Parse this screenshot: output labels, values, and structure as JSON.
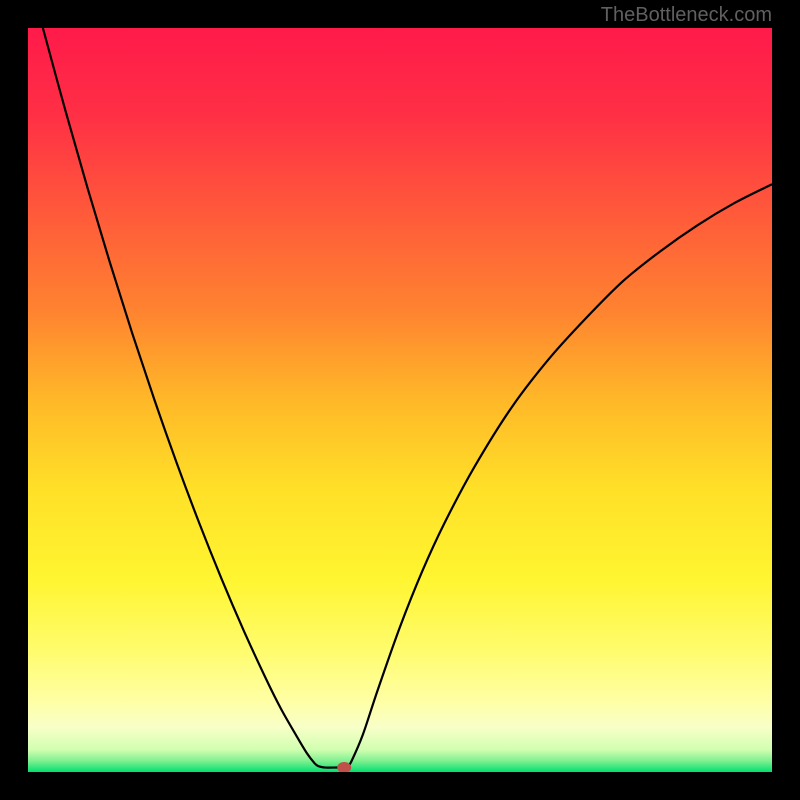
{
  "watermark": "TheBottleneck.com",
  "chart_data": {
    "type": "line",
    "title": "",
    "xlabel": "",
    "ylabel": "",
    "xlim": [
      0,
      100
    ],
    "ylim": [
      0,
      100
    ],
    "background_gradient": {
      "stops": [
        {
          "offset": 0.0,
          "color": "#ff1a4a"
        },
        {
          "offset": 0.12,
          "color": "#ff3045"
        },
        {
          "offset": 0.25,
          "color": "#ff5a3a"
        },
        {
          "offset": 0.38,
          "color": "#ff8330"
        },
        {
          "offset": 0.5,
          "color": "#ffb828"
        },
        {
          "offset": 0.62,
          "color": "#ffe028"
        },
        {
          "offset": 0.74,
          "color": "#fff530"
        },
        {
          "offset": 0.84,
          "color": "#fffc70"
        },
        {
          "offset": 0.9,
          "color": "#ffffa0"
        },
        {
          "offset": 0.94,
          "color": "#f8ffc8"
        },
        {
          "offset": 0.97,
          "color": "#d0ffb0"
        },
        {
          "offset": 0.985,
          "color": "#80f090"
        },
        {
          "offset": 1.0,
          "color": "#00e070"
        }
      ]
    },
    "series": [
      {
        "name": "bottleneck-curve",
        "type": "path",
        "stroke": "#000000",
        "points": [
          {
            "x": 2.0,
            "y": 100.0
          },
          {
            "x": 5.0,
            "y": 89.0
          },
          {
            "x": 8.0,
            "y": 78.5
          },
          {
            "x": 11.0,
            "y": 68.5
          },
          {
            "x": 14.0,
            "y": 59.0
          },
          {
            "x": 17.0,
            "y": 50.0
          },
          {
            "x": 20.0,
            "y": 41.5
          },
          {
            "x": 23.0,
            "y": 33.5
          },
          {
            "x": 26.0,
            "y": 26.0
          },
          {
            "x": 29.0,
            "y": 19.0
          },
          {
            "x": 32.0,
            "y": 12.5
          },
          {
            "x": 34.0,
            "y": 8.5
          },
          {
            "x": 36.0,
            "y": 5.0
          },
          {
            "x": 37.5,
            "y": 2.5
          },
          {
            "x": 38.5,
            "y": 1.2
          },
          {
            "x": 39.0,
            "y": 0.8
          },
          {
            "x": 40.0,
            "y": 0.6
          },
          {
            "x": 41.5,
            "y": 0.6
          },
          {
            "x": 42.5,
            "y": 0.6
          },
          {
            "x": 43.0,
            "y": 0.8
          },
          {
            "x": 43.5,
            "y": 1.5
          },
          {
            "x": 45.0,
            "y": 5.0
          },
          {
            "x": 47.0,
            "y": 11.0
          },
          {
            "x": 50.0,
            "y": 19.5
          },
          {
            "x": 53.0,
            "y": 27.0
          },
          {
            "x": 56.0,
            "y": 33.5
          },
          {
            "x": 60.0,
            "y": 41.0
          },
          {
            "x": 65.0,
            "y": 49.0
          },
          {
            "x": 70.0,
            "y": 55.5
          },
          {
            "x": 75.0,
            "y": 61.0
          },
          {
            "x": 80.0,
            "y": 66.0
          },
          {
            "x": 85.0,
            "y": 70.0
          },
          {
            "x": 90.0,
            "y": 73.5
          },
          {
            "x": 95.0,
            "y": 76.5
          },
          {
            "x": 100.0,
            "y": 79.0
          }
        ]
      }
    ],
    "marker": {
      "x": 42.5,
      "y": 0.6,
      "color": "#c05048"
    }
  }
}
